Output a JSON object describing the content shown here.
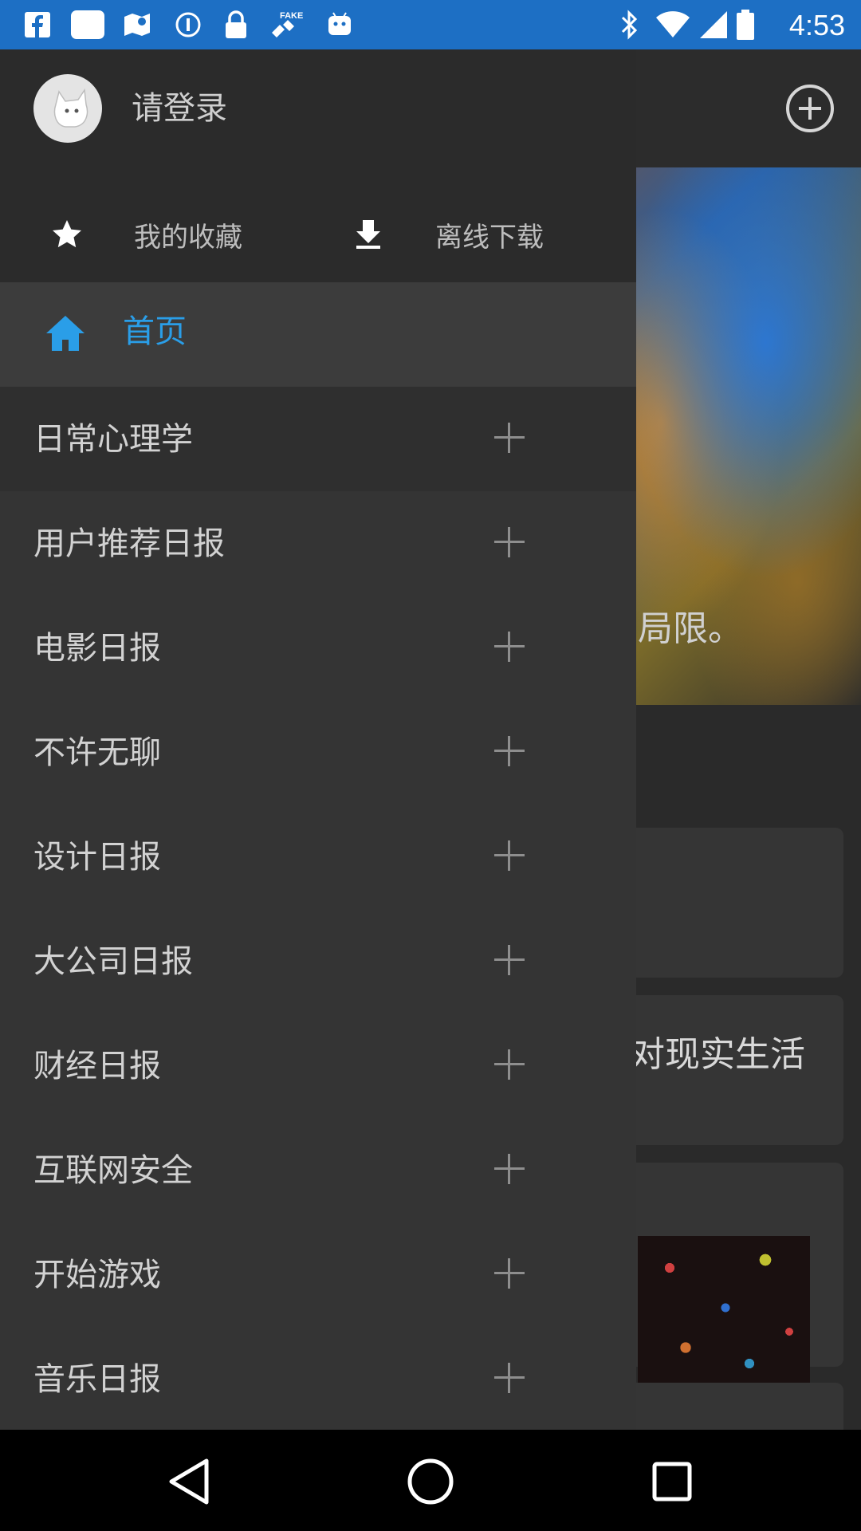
{
  "status_bar": {
    "time": "4:53",
    "icons": [
      "facebook-icon",
      "square-app-icon",
      "maps-icon",
      "info-icon",
      "lock-icon",
      "fake-gps-icon",
      "android-icon",
      "bluetooth-icon",
      "wifi-icon",
      "signal-icon",
      "battery-icon"
    ]
  },
  "background": {
    "hero_caption": "局限。",
    "card_text": "对现实生活"
  },
  "drawer": {
    "login_label": "请登录",
    "favorites_label": "我的收藏",
    "offline_label": "离线下载",
    "home_label": "首页",
    "accent_color": "#2a9ee8",
    "items": [
      {
        "label": "日常心理学"
      },
      {
        "label": "用户推荐日报"
      },
      {
        "label": "电影日报"
      },
      {
        "label": "不许无聊"
      },
      {
        "label": "设计日报"
      },
      {
        "label": "大公司日报"
      },
      {
        "label": "财经日报"
      },
      {
        "label": "互联网安全"
      },
      {
        "label": "开始游戏"
      },
      {
        "label": "音乐日报"
      }
    ]
  },
  "nav": [
    "back-icon",
    "home-circle-icon",
    "recents-icon"
  ]
}
